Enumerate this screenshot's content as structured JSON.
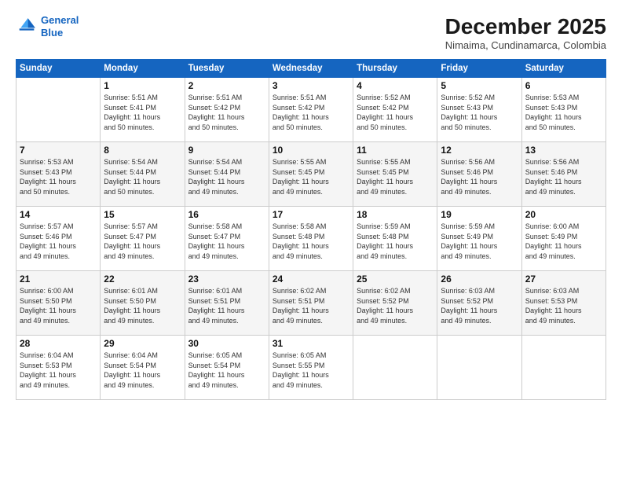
{
  "header": {
    "logo_line1": "General",
    "logo_line2": "Blue",
    "month": "December 2025",
    "location": "Nimaima, Cundinamarca, Colombia"
  },
  "weekdays": [
    "Sunday",
    "Monday",
    "Tuesday",
    "Wednesday",
    "Thursday",
    "Friday",
    "Saturday"
  ],
  "weeks": [
    [
      {
        "day": "",
        "info": ""
      },
      {
        "day": "1",
        "info": "Sunrise: 5:51 AM\nSunset: 5:41 PM\nDaylight: 11 hours\nand 50 minutes."
      },
      {
        "day": "2",
        "info": "Sunrise: 5:51 AM\nSunset: 5:42 PM\nDaylight: 11 hours\nand 50 minutes."
      },
      {
        "day": "3",
        "info": "Sunrise: 5:51 AM\nSunset: 5:42 PM\nDaylight: 11 hours\nand 50 minutes."
      },
      {
        "day": "4",
        "info": "Sunrise: 5:52 AM\nSunset: 5:42 PM\nDaylight: 11 hours\nand 50 minutes."
      },
      {
        "day": "5",
        "info": "Sunrise: 5:52 AM\nSunset: 5:43 PM\nDaylight: 11 hours\nand 50 minutes."
      },
      {
        "day": "6",
        "info": "Sunrise: 5:53 AM\nSunset: 5:43 PM\nDaylight: 11 hours\nand 50 minutes."
      }
    ],
    [
      {
        "day": "7",
        "info": "Sunrise: 5:53 AM\nSunset: 5:43 PM\nDaylight: 11 hours\nand 50 minutes."
      },
      {
        "day": "8",
        "info": "Sunrise: 5:54 AM\nSunset: 5:44 PM\nDaylight: 11 hours\nand 50 minutes."
      },
      {
        "day": "9",
        "info": "Sunrise: 5:54 AM\nSunset: 5:44 PM\nDaylight: 11 hours\nand 49 minutes."
      },
      {
        "day": "10",
        "info": "Sunrise: 5:55 AM\nSunset: 5:45 PM\nDaylight: 11 hours\nand 49 minutes."
      },
      {
        "day": "11",
        "info": "Sunrise: 5:55 AM\nSunset: 5:45 PM\nDaylight: 11 hours\nand 49 minutes."
      },
      {
        "day": "12",
        "info": "Sunrise: 5:56 AM\nSunset: 5:46 PM\nDaylight: 11 hours\nand 49 minutes."
      },
      {
        "day": "13",
        "info": "Sunrise: 5:56 AM\nSunset: 5:46 PM\nDaylight: 11 hours\nand 49 minutes."
      }
    ],
    [
      {
        "day": "14",
        "info": "Sunrise: 5:57 AM\nSunset: 5:46 PM\nDaylight: 11 hours\nand 49 minutes."
      },
      {
        "day": "15",
        "info": "Sunrise: 5:57 AM\nSunset: 5:47 PM\nDaylight: 11 hours\nand 49 minutes."
      },
      {
        "day": "16",
        "info": "Sunrise: 5:58 AM\nSunset: 5:47 PM\nDaylight: 11 hours\nand 49 minutes."
      },
      {
        "day": "17",
        "info": "Sunrise: 5:58 AM\nSunset: 5:48 PM\nDaylight: 11 hours\nand 49 minutes."
      },
      {
        "day": "18",
        "info": "Sunrise: 5:59 AM\nSunset: 5:48 PM\nDaylight: 11 hours\nand 49 minutes."
      },
      {
        "day": "19",
        "info": "Sunrise: 5:59 AM\nSunset: 5:49 PM\nDaylight: 11 hours\nand 49 minutes."
      },
      {
        "day": "20",
        "info": "Sunrise: 6:00 AM\nSunset: 5:49 PM\nDaylight: 11 hours\nand 49 minutes."
      }
    ],
    [
      {
        "day": "21",
        "info": "Sunrise: 6:00 AM\nSunset: 5:50 PM\nDaylight: 11 hours\nand 49 minutes."
      },
      {
        "day": "22",
        "info": "Sunrise: 6:01 AM\nSunset: 5:50 PM\nDaylight: 11 hours\nand 49 minutes."
      },
      {
        "day": "23",
        "info": "Sunrise: 6:01 AM\nSunset: 5:51 PM\nDaylight: 11 hours\nand 49 minutes."
      },
      {
        "day": "24",
        "info": "Sunrise: 6:02 AM\nSunset: 5:51 PM\nDaylight: 11 hours\nand 49 minutes."
      },
      {
        "day": "25",
        "info": "Sunrise: 6:02 AM\nSunset: 5:52 PM\nDaylight: 11 hours\nand 49 minutes."
      },
      {
        "day": "26",
        "info": "Sunrise: 6:03 AM\nSunset: 5:52 PM\nDaylight: 11 hours\nand 49 minutes."
      },
      {
        "day": "27",
        "info": "Sunrise: 6:03 AM\nSunset: 5:53 PM\nDaylight: 11 hours\nand 49 minutes."
      }
    ],
    [
      {
        "day": "28",
        "info": "Sunrise: 6:04 AM\nSunset: 5:53 PM\nDaylight: 11 hours\nand 49 minutes."
      },
      {
        "day": "29",
        "info": "Sunrise: 6:04 AM\nSunset: 5:54 PM\nDaylight: 11 hours\nand 49 minutes."
      },
      {
        "day": "30",
        "info": "Sunrise: 6:05 AM\nSunset: 5:54 PM\nDaylight: 11 hours\nand 49 minutes."
      },
      {
        "day": "31",
        "info": "Sunrise: 6:05 AM\nSunset: 5:55 PM\nDaylight: 11 hours\nand 49 minutes."
      },
      {
        "day": "",
        "info": ""
      },
      {
        "day": "",
        "info": ""
      },
      {
        "day": "",
        "info": ""
      }
    ]
  ]
}
